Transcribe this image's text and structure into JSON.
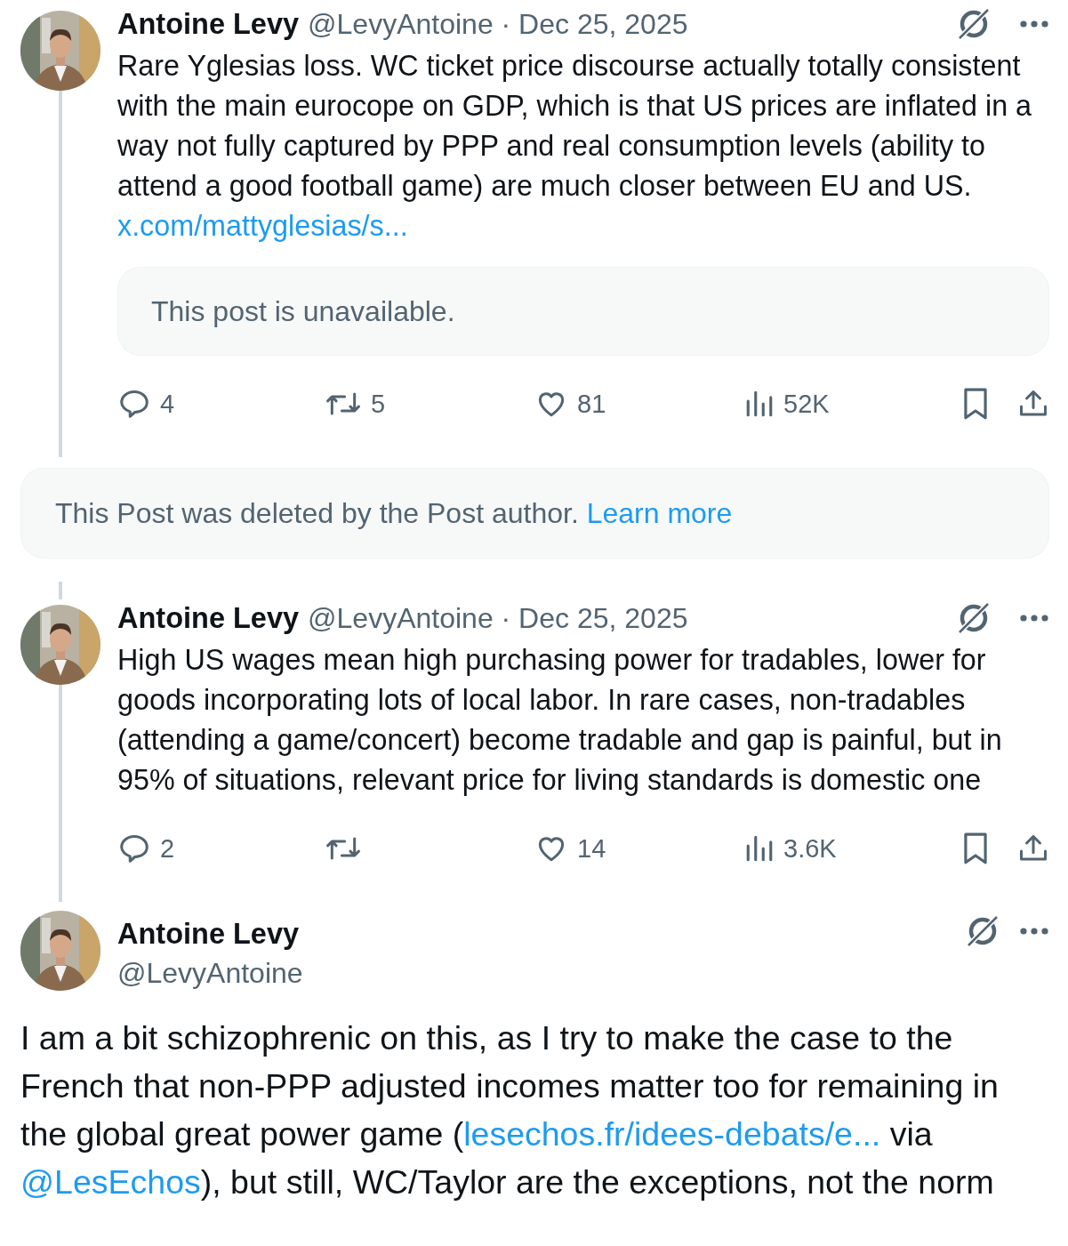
{
  "thread": [
    {
      "kind": "post",
      "author": "Antoine Levy",
      "handle": "@LevyAntoine",
      "separator": "·",
      "date": "Dec 25, 2025",
      "body": [
        {
          "kind": "text",
          "text": "Rare Yglesias loss. WC ticket price discourse actually totally consistent with the main eurocope on GDP, which is that US prices are inflated in a way not fully captured by PPP and real consumption levels (ability to attend a good football game) are much closer between EU and US. "
        },
        {
          "kind": "link",
          "text": "x.com/mattyglesias/s..."
        }
      ],
      "quote": {
        "text": "This post is unavailable."
      },
      "stats": {
        "replies": "4",
        "reposts": "5",
        "likes": "81",
        "views": "52K"
      }
    },
    {
      "kind": "notice",
      "text": "This Post was deleted by the Post author.",
      "link": "Learn more"
    },
    {
      "kind": "post",
      "author": "Antoine Levy",
      "handle": "@LevyAntoine",
      "separator": "·",
      "date": "Dec 25, 2025",
      "body": [
        {
          "kind": "text",
          "text": "High US wages mean high purchasing power for tradables, lower for goods incorporating lots of local labor. In rare cases, non-tradables (attending a game/concert) become tradable and gap is painful, but in 95% of situations, relevant price for living standards is domestic one"
        }
      ],
      "stats": {
        "replies": "2",
        "likes": "14",
        "views": "3.6K"
      }
    },
    {
      "kind": "focus",
      "author": "Antoine Levy",
      "handle": "@LevyAntoine",
      "body": [
        {
          "kind": "text",
          "text": "I am a bit schizophrenic on this, as I try to make the case to the French that non-PPP adjusted incomes matter too for remaining in the global great power game ("
        },
        {
          "kind": "link",
          "text": "lesechos.fr/idees-debats/e..."
        },
        {
          "kind": "text",
          "text": " via "
        },
        {
          "kind": "link",
          "text": "@LesEchos"
        },
        {
          "kind": "text",
          "text": "), but still, WC/Taylor are the exceptions, not the norm"
        }
      ]
    }
  ]
}
